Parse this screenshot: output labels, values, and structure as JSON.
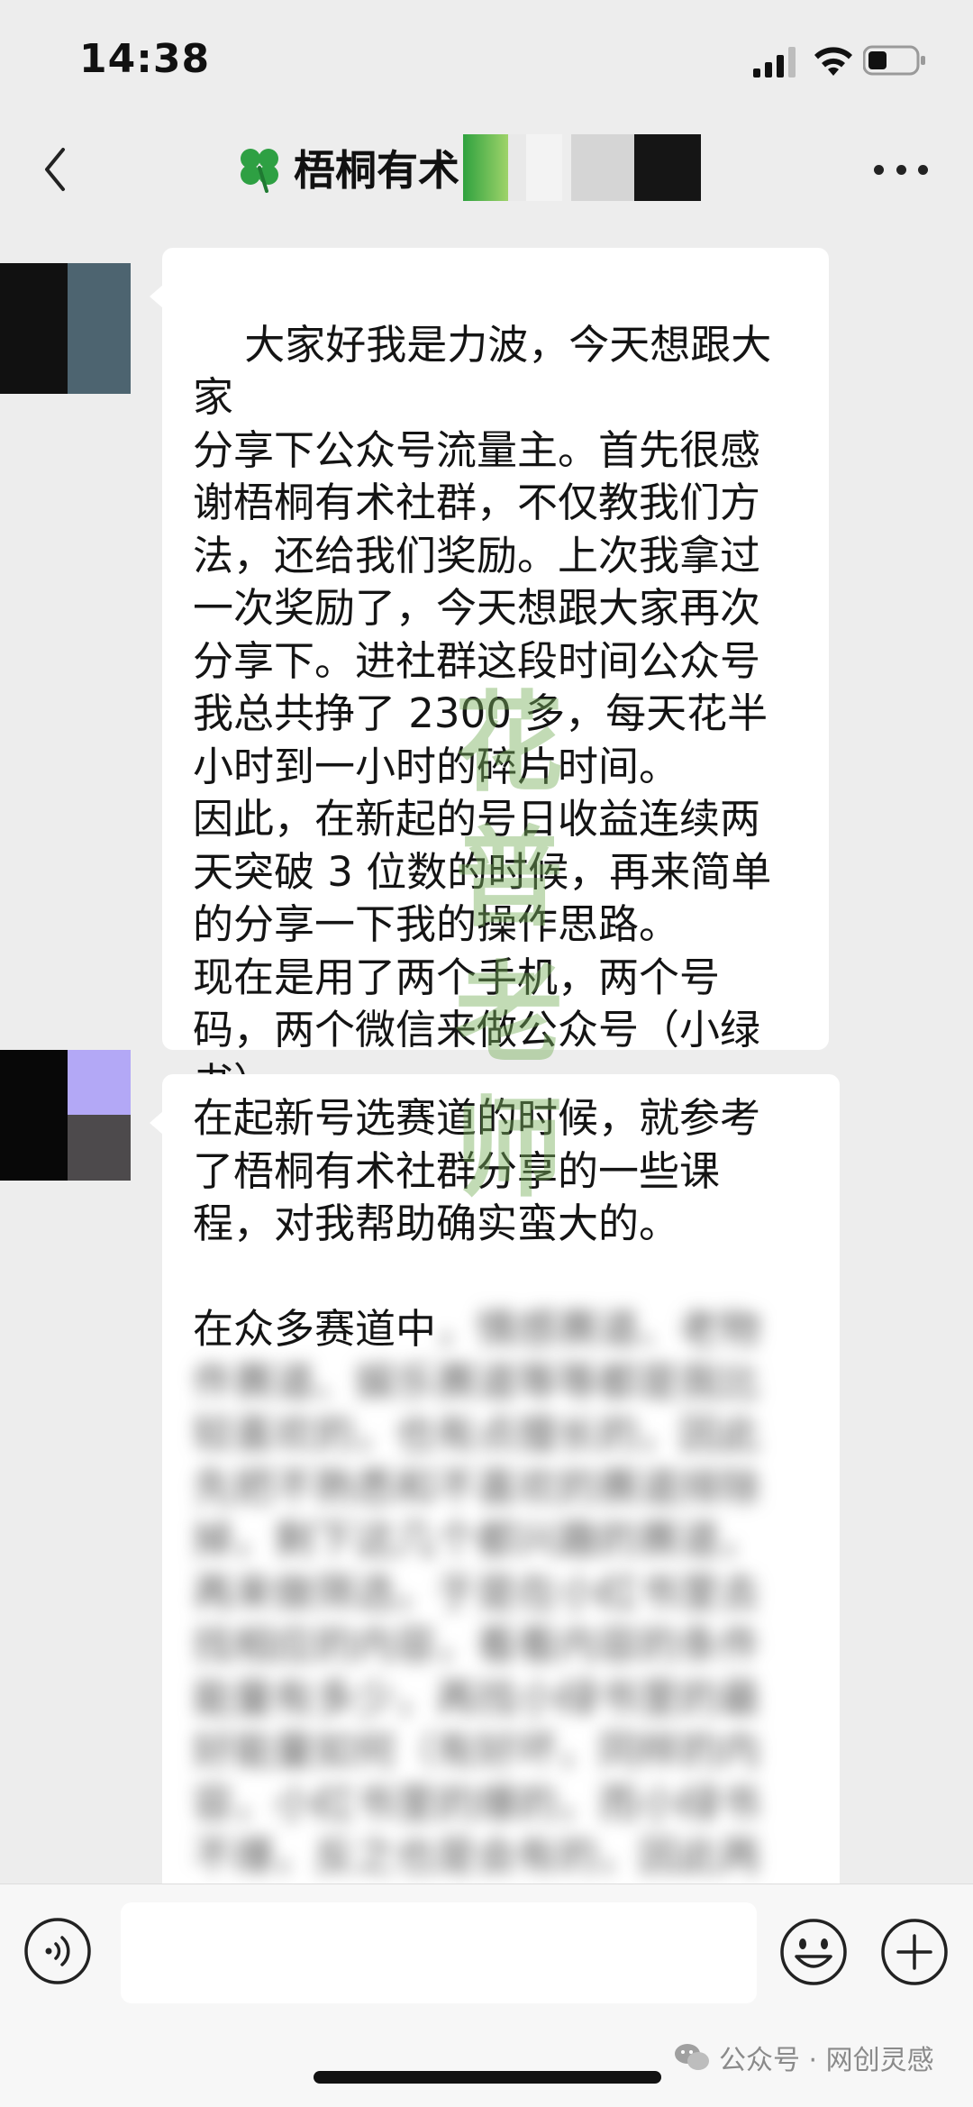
{
  "status_bar": {
    "time": "14:38"
  },
  "header": {
    "title": "梧桐有术"
  },
  "messages": [
    {
      "text": "大家好我是力波，今天想跟大家\n分享下公众号流量主。首先很感\n谢梧桐有术社群，不仅教我们方\n法，还给我们奖励。上次我拿过\n一次奖励了，今天想跟大家再次\n分享下。进社群这段时间公众号\n我总共挣了 2300 多，每天花半\n小时到一小时的碎片时间。\n因此，在新起的号日收益连续两\n天突破 3 位数的时候，再来简单\n的分享一下我的操作思路。\n现在是用了两个手机，两个号\n码，两个微信来做公众号（小绿\n书）。"
    },
    {
      "text": "在起新号选赛道的时候，就参考\n了梧桐有术社群分享的一些课\n程，对我帮助确实蛮大的。\n\n在众多赛道中",
      "blurred_text": "，情感赛道、老物\n件赛道、娱乐赛道等等都是我比\n较喜欢的，也有点擅长的，因此\n先把不熟悉和不喜欢的赛道排除\n掉，剩下这几个都兴趣的赛道，\n再来做筛选，于是在小红书里去\n找相应的内容，看看内容的条件\n能量有多少，再找小绿书里的最\n好能量如何（有好坏，同样的内\n容，小红书里的爆的，而小绿书\n不爆，反之也是会有的，因此两"
    }
  ],
  "watermark": {
    "text": "花普老师"
  },
  "bottom_bar": {
    "input_value": "",
    "source_label": "公众号 · 网创灵感"
  },
  "colors": {
    "background": "#ededed",
    "bubble": "#ffffff",
    "bottom_bar": "#f7f7f7",
    "clover_green": "#2ea043",
    "watermark_green": "#78af5a"
  }
}
